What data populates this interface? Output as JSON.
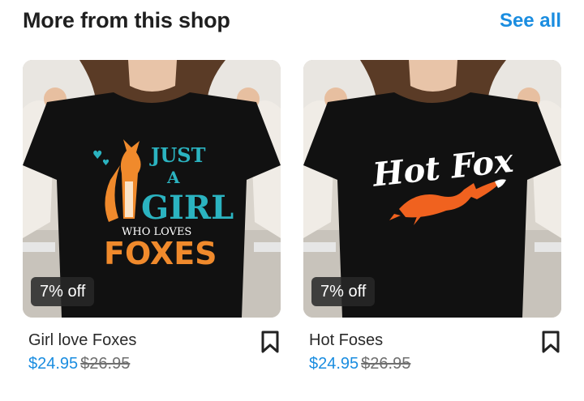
{
  "section": {
    "title": "More from this shop",
    "see_all": "See all"
  },
  "products": [
    {
      "name": "Girl love Foxes",
      "price": "$24.95",
      "old_price": "$26.95",
      "badge": "7% off",
      "design_text": [
        "JUST",
        "A",
        "GIRL",
        "WHO LOVES",
        "FOXES"
      ]
    },
    {
      "name": "Hot Foses",
      "price": "$24.95",
      "old_price": "$26.95",
      "badge": "7% off",
      "design_text": [
        "Hot Fox"
      ]
    }
  ],
  "colors": {
    "accent": "#1a8de0",
    "shirt": "#111111",
    "design_teal": "#2bb3c0",
    "design_orange": "#f08a2c"
  },
  "icons": {
    "bookmark": "bookmark-icon"
  }
}
